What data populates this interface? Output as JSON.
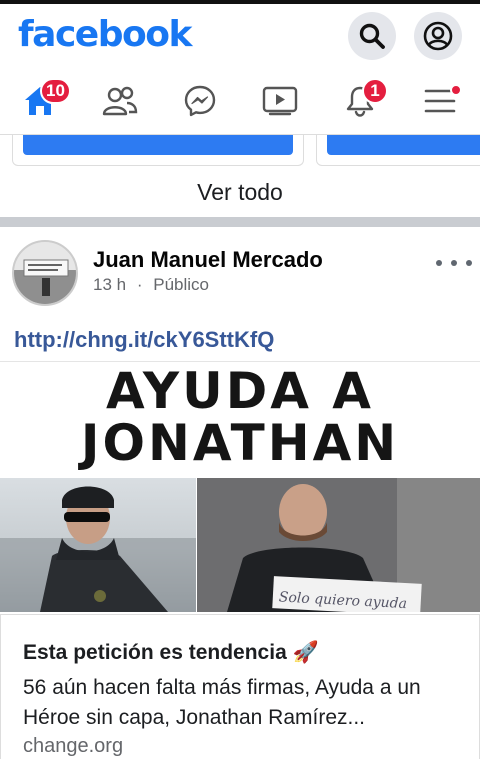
{
  "header": {
    "logo": "facebook",
    "search_icon": "search-icon",
    "profile_icon": "user-circle-icon"
  },
  "nav": {
    "items": [
      {
        "name": "home",
        "icon": "home-icon",
        "badge": "10",
        "active": true
      },
      {
        "name": "friends",
        "icon": "friends-icon"
      },
      {
        "name": "messenger",
        "icon": "messenger-icon"
      },
      {
        "name": "watch",
        "icon": "video-icon"
      },
      {
        "name": "notifications",
        "icon": "bell-icon",
        "badge": "1"
      },
      {
        "name": "menu",
        "icon": "hamburger-menu-icon",
        "dot": true
      }
    ]
  },
  "feed": {
    "see_all_label": "Ver todo"
  },
  "post": {
    "author": "Juan Manuel Mercado",
    "time": "13 h",
    "separator": "·",
    "audience": "Público",
    "link_text": "http://chng.it/ckY6SttKfQ",
    "image": {
      "line1": "AYUDA A",
      "line2": "JONATHAN",
      "sign_text": "Solo quiero ayuda"
    },
    "preview": {
      "title": "Esta petición es tendencia 🚀",
      "description": "56 aún hacen falta más firmas, Ayuda a un Héroe sin capa, Jonathan Ramírez...",
      "domain": "change.org"
    }
  },
  "colors": {
    "brand": "#1877f2",
    "badge": "#e41e3f",
    "link": "#385898",
    "separator": "#c9ccd1"
  }
}
